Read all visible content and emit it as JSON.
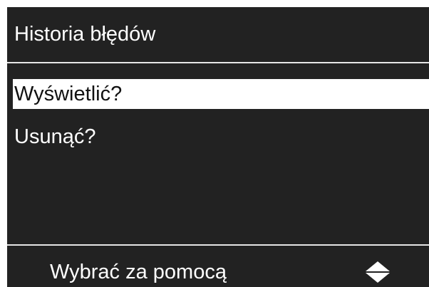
{
  "header": {
    "title": "Historia błędów"
  },
  "menu": {
    "items": [
      {
        "label": "Wyświetlić?",
        "selected": true
      },
      {
        "label": "Usunąć?",
        "selected": false
      }
    ]
  },
  "footer": {
    "hint": "Wybrać za pomocą",
    "icon": "up-down-arrows-icon"
  },
  "colors": {
    "background": "#222222",
    "foreground": "#ffffff",
    "highlight": "#ffffff",
    "highlight_text": "#111111"
  }
}
